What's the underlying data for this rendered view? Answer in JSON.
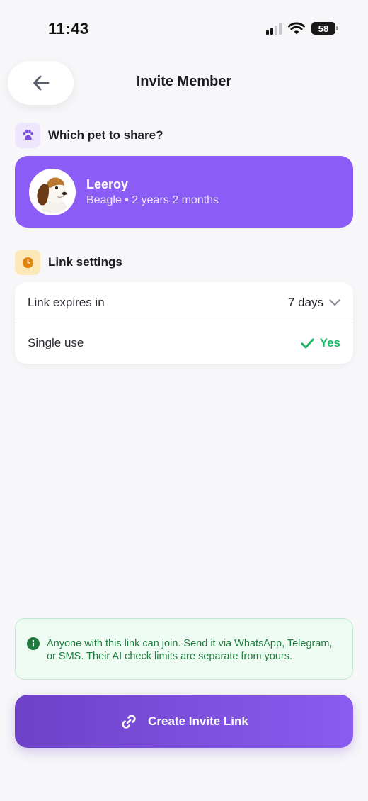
{
  "status_bar": {
    "time": "11:43",
    "battery": "58"
  },
  "header": {
    "title": "Invite Member",
    "back_icon": "arrow-left-icon"
  },
  "pet_section": {
    "label": "Which pet to share?",
    "icon": "paw-icon"
  },
  "pet": {
    "name": "Leeroy",
    "details": "Beagle • 2 years 2 months"
  },
  "link_section": {
    "label": "Link settings",
    "icon": "clock-icon"
  },
  "settings": {
    "expires_label": "Link expires in",
    "expires_value": "7 days",
    "single_use_label": "Single use",
    "single_use_value": "Yes"
  },
  "info": {
    "text": "Anyone with this link can join. Send it via WhatsApp, Telegram, or SMS. Their AI check limits are separate from yours."
  },
  "cta": {
    "label": "Create Invite Link"
  },
  "colors": {
    "accent": "#8b5cf6",
    "success": "#22b36b",
    "info_bg": "#eefbf2",
    "warning_bg": "#fde9b8"
  }
}
